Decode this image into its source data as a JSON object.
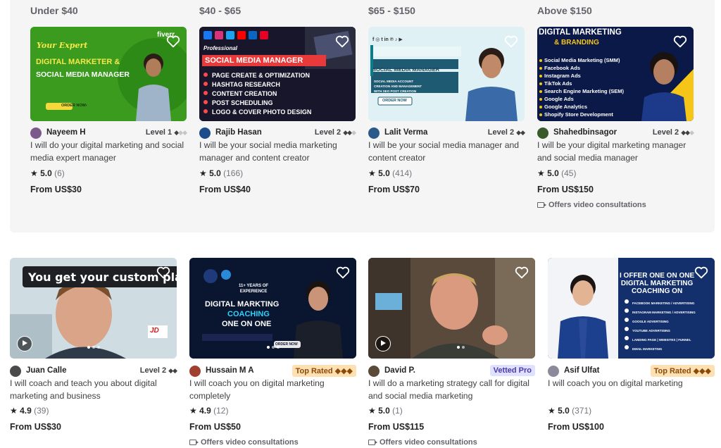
{
  "budget_cards": [
    {
      "budget": "Under $40",
      "seller": "Nayeem H",
      "level": "Level 1",
      "level_diamonds": "◆◆◆",
      "level_filled": 1,
      "title": "I will do your digital marketing and social media expert manager",
      "rating": "5.0",
      "reviews": "(6)",
      "price": "From US$30",
      "thumb": {
        "line1": "Your Expert",
        "line2": "DIGITAL MARKETER &",
        "line3": "SOCIAL MEDIA MANAGER",
        "brand": "fiverr.",
        "cta": "ORDER NOW›"
      },
      "colors": {
        "bg": "#3b9a1c",
        "avatar": "#7a5a8c"
      }
    },
    {
      "budget": "$40 - $65",
      "seller": "Rajib Hasan",
      "level": "Level 2",
      "level_diamonds": "◆◆◆",
      "level_filled": 2,
      "title": "I will be your social media marketing manager and content creator",
      "rating": "5.0",
      "reviews": "(166)",
      "price": "From US$40",
      "thumb": {
        "line1": "Professional",
        "line2": "SOCIAL MEDIA MANAGER",
        "bullets": [
          "PAGE CREATE & OPTIMIZATION",
          "HASHTAG RESEARCH",
          "CONTENT CREATION",
          "POST SCHEDULING",
          "LOGO & COVER PHOTO DESIGN"
        ]
      },
      "colors": {
        "bg": "#14131f",
        "avatar": "#1d4c8a"
      }
    },
    {
      "budget": "$65 - $150",
      "seller": "Lalit Verma",
      "level": "Level 2",
      "level_diamonds": "◆◆",
      "level_filled": 2,
      "title": "I will be your social media manager and content creator",
      "rating": "5.0",
      "reviews": "(414)",
      "price": "From US$70",
      "thumb": {
        "line1": "SOCIAL MEDIA MANAGER",
        "line2": "SOCIAL MEDIA ACCOUNT",
        "line3": "CREATION AND MANAGEMENT",
        "line4": "WITH SEO POST CREATION",
        "cta": "ORDER NOW"
      },
      "colors": {
        "bg": "#d7eef2",
        "avatar": "#2a5a8a"
      }
    },
    {
      "budget": "Above $150",
      "seller": "Shahedbinsagor",
      "level": "Level 2",
      "level_diamonds": "◆◆◆",
      "level_filled": 2,
      "title": "I will be your digital marketing manager and social media manager",
      "rating": "5.0",
      "reviews": "(45)",
      "price": "From US$150",
      "video": "Offers video consultations",
      "thumb": {
        "line1": "DIGITAL MARKETING",
        "line2": "& BRANDING",
        "bullets": [
          "Social Media Marketing (SMM)",
          "Facebook Ads",
          "Instagram Ads",
          "TikTok Ads",
          "Search Engine Marketing (SEM)",
          "Google Ads",
          "Google Analytics",
          "Shopify Store Development"
        ]
      },
      "colors": {
        "bg": "#0c1a4a",
        "avatar": "#3a5a2a"
      }
    }
  ],
  "gig_cards": [
    {
      "seller": "Juan Calle",
      "level": "Level 2",
      "level_diamonds": "◆◆",
      "level_filled": 2,
      "title": "I will coach and teach you about digital marketing and business",
      "rating": "4.9",
      "reviews": "(39)",
      "price": "From US$30",
      "thumb": {
        "line1": "You get your custom plan",
        "logo": "JD"
      },
      "colors": {
        "bg": "#c9d6dc",
        "avatar": "#4a4a4a"
      }
    },
    {
      "seller": "Hussain M A",
      "badge": "Top Rated ◆◆◆",
      "title": "I will coach you on digital marketing completely",
      "rating": "4.9",
      "reviews": "(12)",
      "price": "From US$50",
      "video": "Offers video consultations",
      "thumb": {
        "line1": "11+ YEARS OF",
        "line2": "EXPERIENCE",
        "line3": "DIGITAL MARKTING",
        "line4": "COACHING",
        "line5": "ONE ON ONE",
        "cta": "ORDER NOW"
      },
      "colors": {
        "bg": "#0b1633",
        "avatar": "#a04030"
      }
    },
    {
      "seller": "David P.",
      "badge": "Vetted Pro",
      "title": "I will do a marketing strategy call for digital and social media marketing",
      "rating": "5.0",
      "reviews": "(1)",
      "price": "From US$115",
      "video": "Offers video consultations",
      "thumb": {},
      "colors": {
        "bg": "#6a5a48",
        "avatar": "#5a4a3a"
      }
    },
    {
      "seller": "Asif Ulfat",
      "badge": "Top Rated ◆◆◆",
      "title": "I will coach you on digital marketing",
      "rating": "5.0",
      "reviews": "(371)",
      "price": "From US$100",
      "thumb": {
        "line1": "I OFFER ONE ON ONE",
        "line2": "DIGITAL MARKETING",
        "line3": "COACHING ON",
        "bullets": [
          "FACEBOOK MARKETING / ADVERTISING",
          "INSTAGRAM MARKETING / ADVERTISING",
          "GOOGLE ADVERTISING",
          "YOUTUBE ADVERTISING",
          "LANDING PAGE | WEBSITES | FUNNEL",
          "EMAIL MARKETING"
        ]
      },
      "colors": {
        "bg": "#14306e",
        "avatar": "#8a8a9a"
      }
    }
  ],
  "icons": {
    "favorite": "heart-icon",
    "rating": "star-icon",
    "video": "video-camera-icon",
    "play": "play-icon"
  }
}
